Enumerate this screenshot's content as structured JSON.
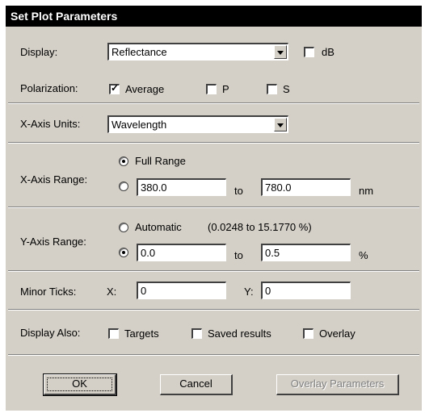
{
  "window": {
    "title": "Set Plot Parameters"
  },
  "display": {
    "label": "Display:",
    "value": "Reflectance",
    "db_label": "dB",
    "db_checked": false
  },
  "polarization": {
    "label": "Polarization:",
    "average_label": "Average",
    "average_checked": true,
    "p_label": "P",
    "p_checked": false,
    "s_label": "S",
    "s_checked": false
  },
  "xunits": {
    "label": "X-Axis Units:",
    "value": "Wavelength"
  },
  "xrange": {
    "label": "X-Axis Range:",
    "full_label": "Full Range",
    "selected": "full",
    "from": "380.0",
    "to_label": "to",
    "to": "780.0",
    "unit": "nm"
  },
  "yrange": {
    "label": "Y-Axis Range:",
    "auto_label": "Automatic",
    "auto_info": "(0.0248  to  15.1770 %)",
    "selected": "manual",
    "from": "0.0",
    "to_label": "to",
    "to": "0.5",
    "unit": "%"
  },
  "ticks": {
    "label": "Minor Ticks:",
    "x_label": "X:",
    "x": "0",
    "y_label": "Y:",
    "y": "0"
  },
  "also": {
    "label": "Display Also:",
    "targets_label": "Targets",
    "saved_label": "Saved results",
    "overlay_label": "Overlay"
  },
  "buttons": {
    "ok": "OK",
    "cancel": "Cancel",
    "overlay_params": "Overlay Parameters"
  }
}
